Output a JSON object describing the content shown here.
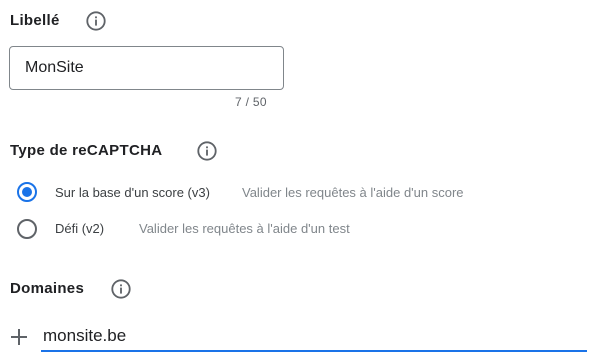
{
  "label_section": {
    "title": "Libellé",
    "input_value": "MonSite",
    "counter": "7 / 50"
  },
  "type_section": {
    "title": "Type de reCAPTCHA",
    "options": [
      {
        "label": "Sur la base d'un score (v3)",
        "description": "Valider les requêtes à l'aide d'un score",
        "selected": true
      },
      {
        "label": "Défi (v2)",
        "description": "Valider les requêtes à l'aide d'un test",
        "selected": false
      }
    ]
  },
  "domains_section": {
    "title": "Domaines",
    "input_value": "monsite.be"
  },
  "icons": {
    "info": "info-icon",
    "add": "plus-icon"
  },
  "colors": {
    "accent": "#1a73e8",
    "text": "#202124",
    "secondary": "#80868b",
    "border": "#80868b"
  }
}
